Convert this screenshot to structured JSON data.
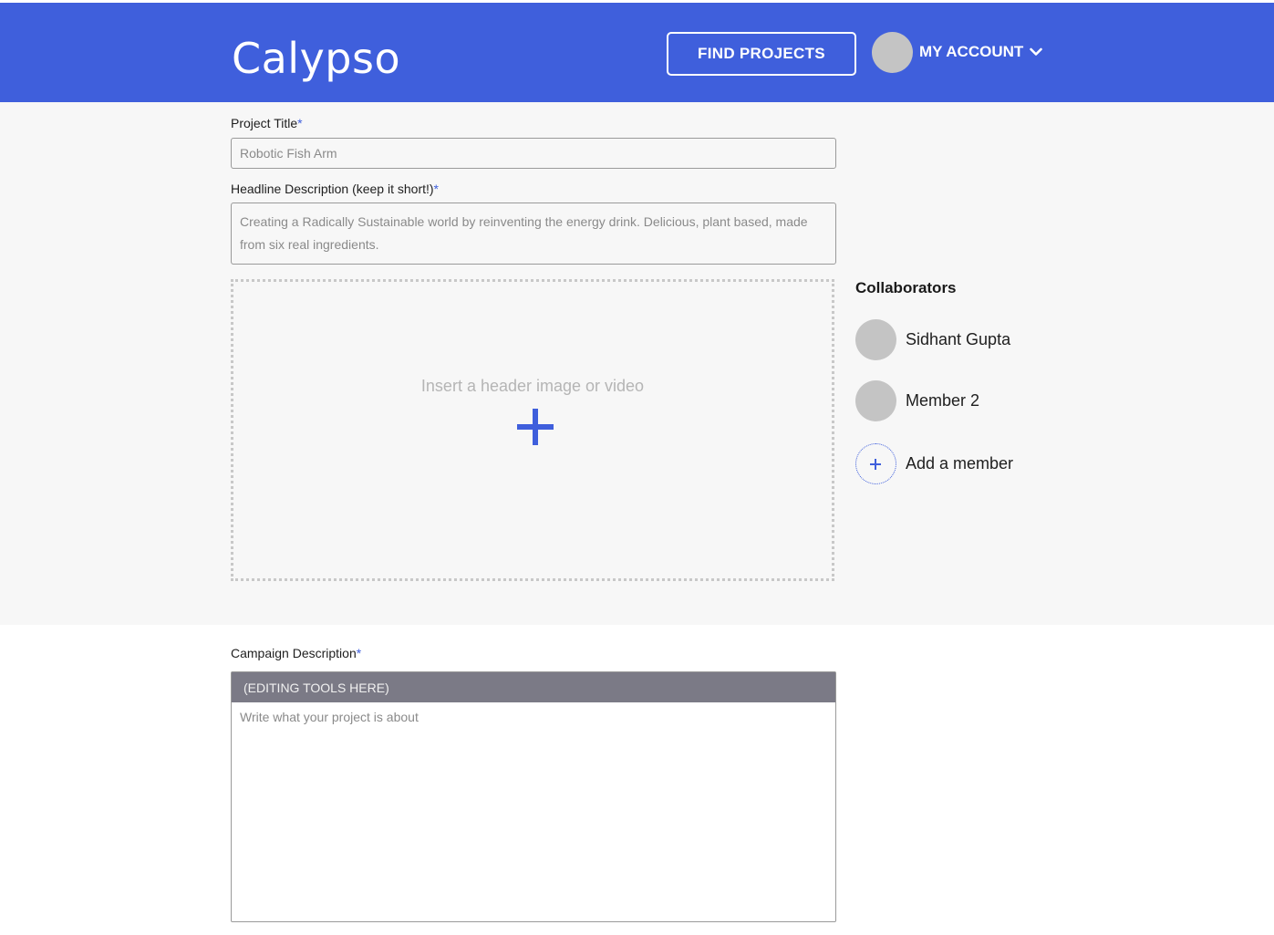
{
  "header": {
    "logo": "Calypso",
    "find_projects": "FIND PROJECTS",
    "account_label": "MY ACCOUNT"
  },
  "form": {
    "project_title": {
      "label": "Project Title",
      "required_mark": "*",
      "value": "Robotic Fish Arm"
    },
    "headline": {
      "label": "Headline Description (keep it short!)",
      "required_mark": "*",
      "value": "Creating a Radically Sustainable world by reinventing the energy drink. Delicious, plant based, made from six real ingredients."
    },
    "media_upload": {
      "text": "Insert a header image or video"
    },
    "campaign": {
      "label": "Campaign Description",
      "required_mark": "*",
      "toolbar": "(EDITING TOOLS HERE)",
      "placeholder": "Write what your project is about"
    }
  },
  "collaborators": {
    "title": "Collaborators",
    "members": [
      {
        "name": "Sidhant Gupta"
      },
      {
        "name": "Member 2"
      }
    ],
    "add_label": "Add a member"
  },
  "colors": {
    "brand": "#3f5fdc",
    "toolbar": "#7b7a86",
    "avatar": "#c4c4c4"
  }
}
